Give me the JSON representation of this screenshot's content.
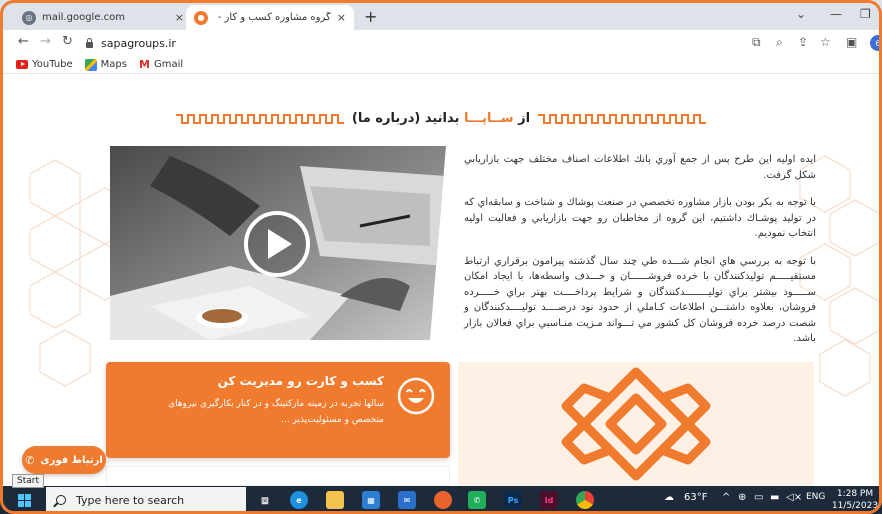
{
  "browser": {
    "tabs": [
      {
        "title": "mail.google.com",
        "close": "×"
      },
      {
        "title": "گروه مشاوره کسب و کار - ساپـا |",
        "close": "×"
      }
    ],
    "new_tab": "+",
    "url": "sapagroups.ir",
    "profile_initial": "6",
    "bookmarks": [
      "YouTube",
      "Maps",
      "Gmail"
    ]
  },
  "page": {
    "heading_prefix": "از ",
    "heading_accent": "ســاپـــا",
    "heading_suffix": " بدانید (درباره ما)",
    "paragraphs": [
      "ايده اوليه اين طرح پس از جمع آوري بانك اطلاعات اصناف مختلف جهت بازاريابي شكل گرفت.",
      "با توجه به بكر بودن بازار مشاوره تخصصي در صنعت پوشاك و شناخت و سابقه‌اي كه در توليد پوشـاك داشتيم، اين گروه از مخاطبان رو جهت بازاريابي و فعاليت اوليه انتخاب نموديم.",
      "با توجه به بررسي هاي انجام شـــده طي چند سال گذشته پيرامون برقراري ارتباط مستقيـــــم توليدكنندگان با خرده فروشــــــان و حـــذف واسطه‌ها، با ايجاد امكان ســـــود بيشتر براي توليــــــــدكنندگان و شرايط پرداخــــت بهتر براي خـــــرده فروشان، بعلاوه داشتـــن اطلاعات كـاملي از حدود نود درصــــد توليــــدكنندگان و شصت درصد خرده فروشان كل كشور مي تـــواند مـزيت منـاسبي براي فعالان بازار باشد."
    ],
    "card": {
      "title": "کسب و کارت رو مدیریت کن",
      "description": "سالها تجربه در زمینه مارکتینگ و در کنار بکارگیری نیروهای متخصص و مسئولیت‌پذیر ..."
    },
    "fab_label": "ارتباط فوری"
  },
  "colors": {
    "accent": "#f07a2d",
    "taskbar": "#1c2a3a"
  },
  "taskbar": {
    "start_tooltip": "Start",
    "search_placeholder": "Type here to search",
    "apps": [
      "task-view",
      "edge",
      "file-explorer",
      "store",
      "mail",
      "firefox",
      "whatsapp",
      "photoshop",
      "indesign",
      "chrome"
    ],
    "weather": "63°F",
    "language": "ENG",
    "time": "1:28 PM",
    "date": "11/5/2023"
  }
}
